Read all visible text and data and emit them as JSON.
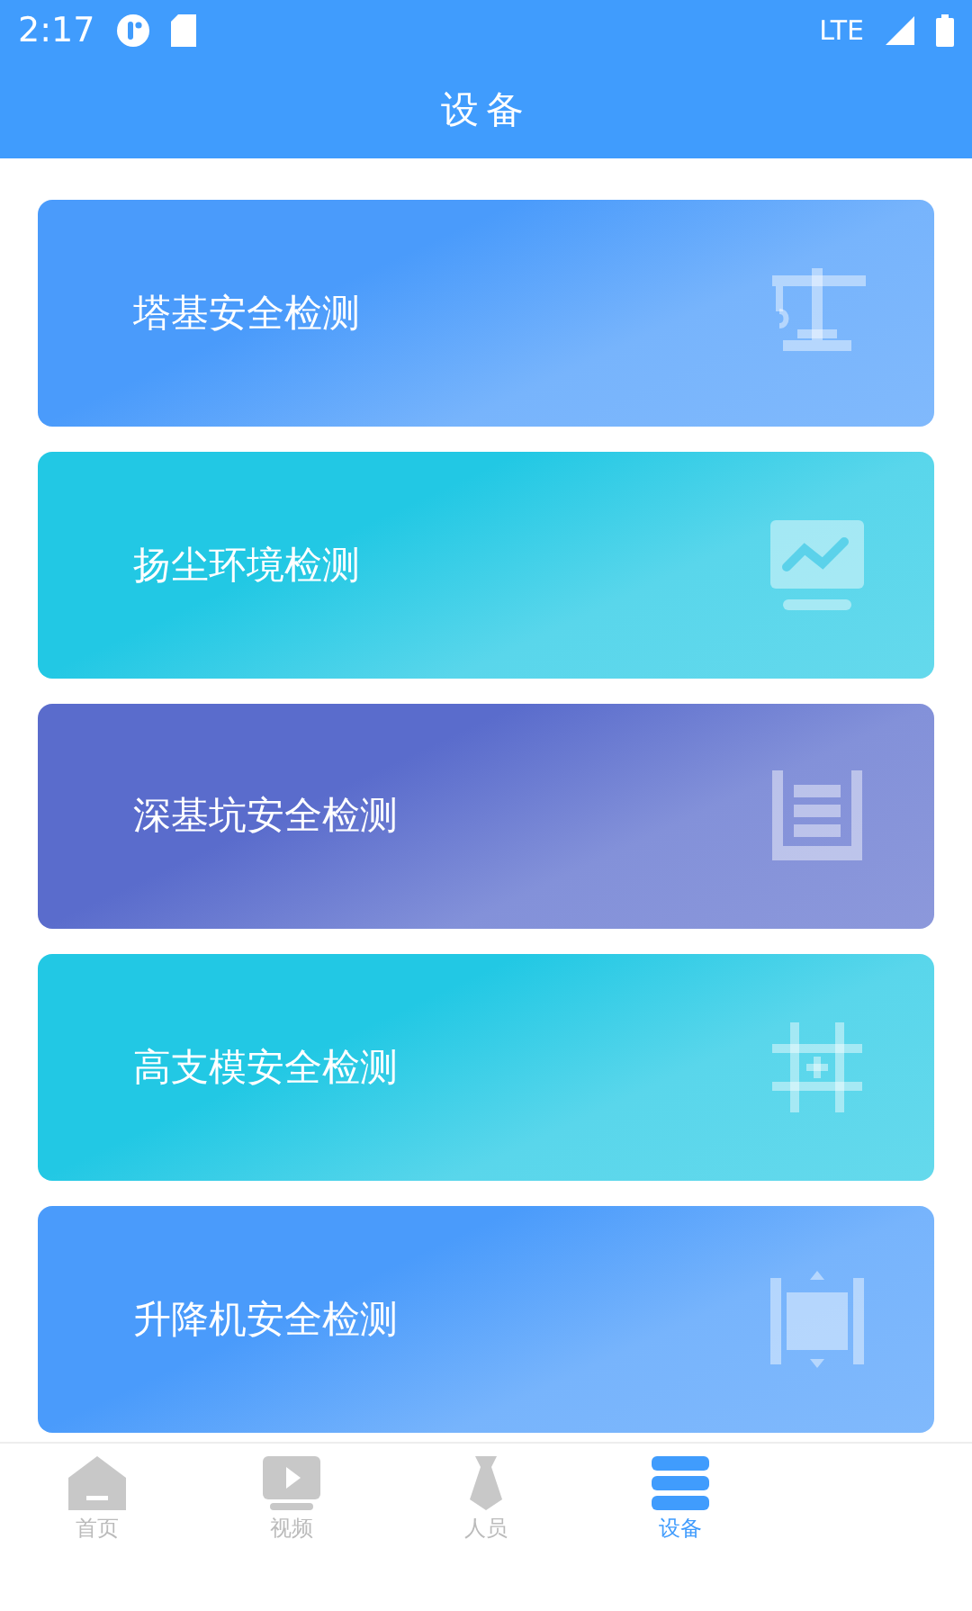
{
  "status_bar": {
    "time": "2:17",
    "network": "LTE"
  },
  "header": {
    "title": "设备"
  },
  "cards": [
    {
      "label": "塔基安全检测",
      "kind": "crane",
      "color": "#4a9bfb"
    },
    {
      "label": "扬尘环境检测",
      "kind": "monitor",
      "color": "#22c8e4"
    },
    {
      "label": "深基坑安全检测",
      "kind": "pit",
      "color": "#5a6ccc"
    },
    {
      "label": "高支模安全检测",
      "kind": "grid",
      "color": "#22c8e4"
    },
    {
      "label": "升降机安全检测",
      "kind": "lift",
      "color": "#4a9bfb"
    }
  ],
  "tabs": [
    {
      "label": "首页",
      "kind": "home",
      "selected": false
    },
    {
      "label": "视频",
      "kind": "video",
      "selected": false
    },
    {
      "label": "人员",
      "kind": "tie",
      "selected": false
    },
    {
      "label": "设备",
      "kind": "list",
      "selected": true
    }
  ]
}
